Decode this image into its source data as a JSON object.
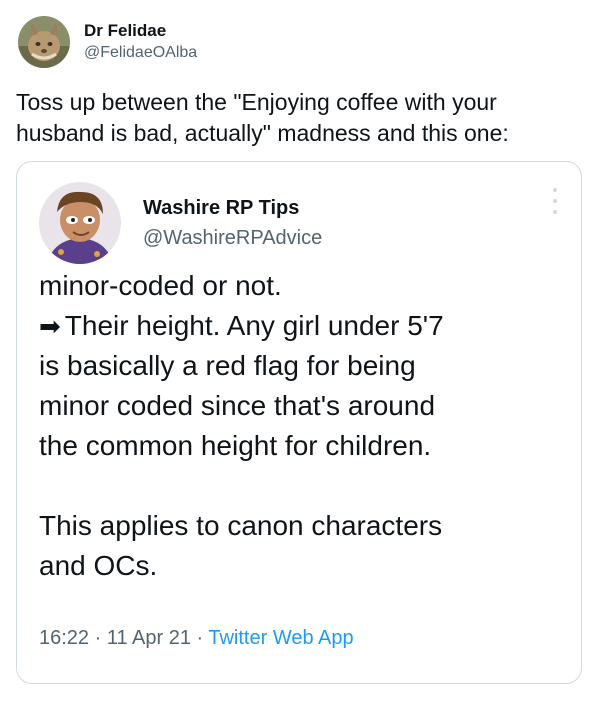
{
  "tweet": {
    "author": {
      "display_name": "Dr Felidae",
      "handle": "@FelidaeOAlba",
      "avatar_icon": "lynx-avatar-icon"
    },
    "text": "Toss up between the \"Enjoying coffee with your husband is bad, actually\" madness and this one:"
  },
  "quoted_tweet": {
    "author": {
      "display_name": "Washire RP Tips",
      "handle": "@WashireRPAdvice",
      "avatar_icon": "cartoon-character-avatar-icon"
    },
    "more_icon": "more-options-icon",
    "lines": [
      "minor-coded or not.",
      "Their height. Any girl under 5'7",
      "is basically a red flag for being",
      "minor coded since that's around",
      "the common height for children.",
      "This applies to canon characters",
      "and OCs."
    ],
    "arrow_glyph": "➡",
    "timestamp": "16:22 · 11 Apr 21 · ",
    "source": "Twitter Web App"
  },
  "colors": {
    "text": "#0f1419",
    "muted": "#536471",
    "link": "#1d9bf0",
    "border": "#cfd9de"
  }
}
